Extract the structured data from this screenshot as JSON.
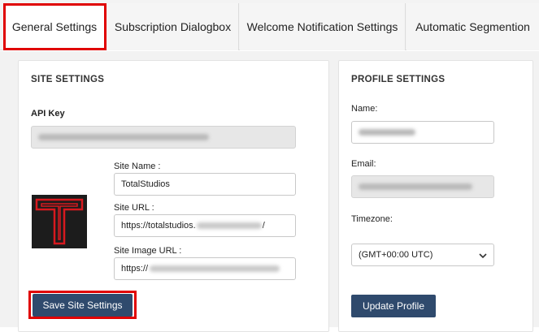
{
  "tabs": [
    {
      "label": "General Settings",
      "active": true
    },
    {
      "label": "Subscription Dialogbox",
      "active": false
    },
    {
      "label": "Welcome Notification Settings",
      "active": false
    },
    {
      "label": "Automatic Segmention",
      "active": false
    }
  ],
  "site_settings": {
    "title": "SITE SETTINGS",
    "api_key_label": "API Key",
    "site_name_label": "Site Name :",
    "site_name_value": "TotalStudios",
    "site_url_label": "Site URL :",
    "site_url_prefix": "https://totalstudios.",
    "site_url_suffix": "/",
    "site_image_url_label": "Site Image URL :",
    "site_image_url_prefix": "https://",
    "save_button": "Save Site Settings"
  },
  "profile_settings": {
    "title": "PROFILE SETTINGS",
    "name_label": "Name:",
    "email_label": "Email:",
    "timezone_label": "Timezone:",
    "timezone_value": "(GMT+00:00 UTC)",
    "update_button": "Update Profile"
  },
  "colors": {
    "highlight": "#e00000",
    "button": "#2f4a6d",
    "logo_bg": "#1c1c1c",
    "logo_mark": "#d7191f"
  },
  "icons": {
    "select_arrow": "chevron-down-icon",
    "logo": "totalstudios-t-logo"
  }
}
